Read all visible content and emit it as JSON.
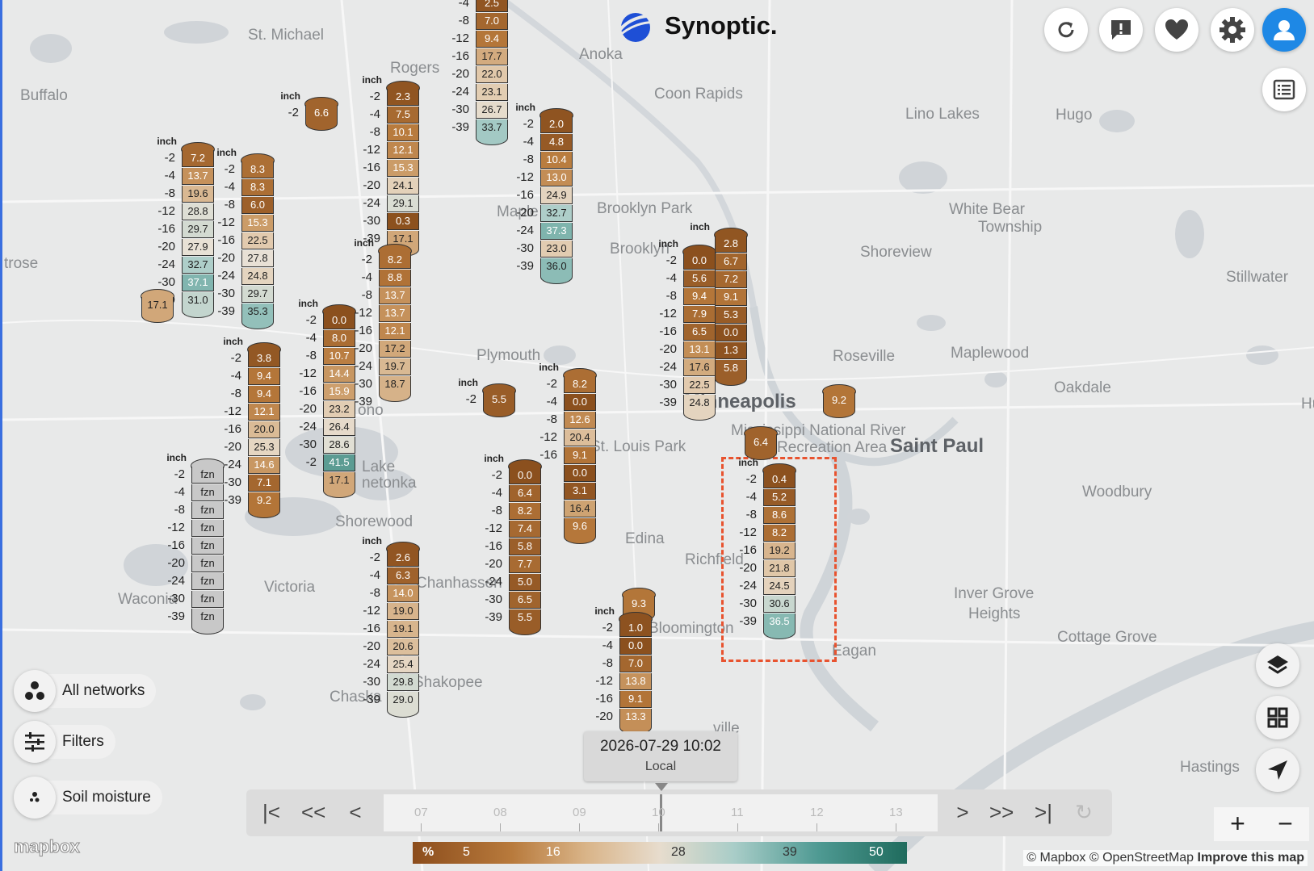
{
  "brand": {
    "name": "Synoptic.",
    "logo_icon": "synoptic-globe-icon"
  },
  "places": [
    {
      "id": "st-michael",
      "label": "St. Michael",
      "cls": ""
    },
    {
      "id": "anoka",
      "label": "Anoka",
      "cls": ""
    },
    {
      "id": "coon-rapids",
      "label": "Coon Rapids",
      "cls": ""
    },
    {
      "id": "buffalo",
      "label": "Buffalo",
      "cls": ""
    },
    {
      "id": "rogers",
      "label": "Rogers",
      "cls": ""
    },
    {
      "id": "lino-lakes",
      "label": "Lino Lakes",
      "cls": ""
    },
    {
      "id": "hugo",
      "label": "Hugo",
      "cls": ""
    },
    {
      "id": "brooklyn-park",
      "label": "Brooklyn Park",
      "cls": ""
    },
    {
      "id": "brooklyn",
      "label": "Brooklyn",
      "cls": ""
    },
    {
      "id": "white-bear",
      "label": "White Bear",
      "cls": ""
    },
    {
      "id": "township",
      "label": "Township",
      "cls": ""
    },
    {
      "id": "shoreview",
      "label": "Shoreview",
      "cls": ""
    },
    {
      "id": "stillwater",
      "label": "Stillwater",
      "cls": ""
    },
    {
      "id": "rose",
      "label": "trose",
      "cls": ""
    },
    {
      "id": "maple",
      "label": "Maple",
      "cls": ""
    },
    {
      "id": "plymouth",
      "label": "Plymouth",
      "cls": ""
    },
    {
      "id": "roseville",
      "label": "Roseville",
      "cls": ""
    },
    {
      "id": "maplewood",
      "label": "Maplewood",
      "cls": ""
    },
    {
      "id": "oakdale",
      "label": "Oakdale",
      "cls": ""
    },
    {
      "id": "minneapolis",
      "label": "Minneapolis",
      "cls": "big"
    },
    {
      "id": "saint-paul",
      "label": "Saint Paul",
      "cls": "big"
    },
    {
      "id": "mississippi",
      "label": "Mississippi National River",
      "cls": ""
    },
    {
      "id": "recreation",
      "label": "and Recreation Area",
      "cls": ""
    },
    {
      "id": "st-louis-park",
      "label": "St. Louis Park",
      "cls": ""
    },
    {
      "id": "woodbury",
      "label": "Woodbury",
      "cls": ""
    },
    {
      "id": "edina",
      "label": "Edina",
      "cls": ""
    },
    {
      "id": "richfield",
      "label": "Richfield",
      "cls": ""
    },
    {
      "id": "shorewood",
      "label": "Shorewood",
      "cls": ""
    },
    {
      "id": "victoria",
      "label": "Victoria",
      "cls": ""
    },
    {
      "id": "waconia",
      "label": "Waconia",
      "cls": ""
    },
    {
      "id": "chanhassen",
      "label": "Chanhassen",
      "cls": ""
    },
    {
      "id": "chaska",
      "label": "Chaska",
      "cls": ""
    },
    {
      "id": "shakopee",
      "label": "Shakopee",
      "cls": ""
    },
    {
      "id": "bloomington",
      "label": "Bloomington",
      "cls": ""
    },
    {
      "id": "eagan",
      "label": "Eagan",
      "cls": ""
    },
    {
      "id": "inver-grove",
      "label": "Inver Grove",
      "cls": ""
    },
    {
      "id": "heights",
      "label": "Heights",
      "cls": ""
    },
    {
      "id": "cottage-grove",
      "label": "Cottage Grove",
      "cls": ""
    },
    {
      "id": "hastings",
      "label": "Hastings",
      "cls": ""
    },
    {
      "id": "burnsville",
      "label": "ville",
      "cls": ""
    },
    {
      "id": "wayzata",
      "label": "ono",
      "cls": ""
    },
    {
      "id": "lake",
      "label": "Lake",
      "cls": ""
    },
    {
      "id": "minnetonka",
      "label": "netonka",
      "cls": ""
    },
    {
      "id": "hu",
      "label": "Hu",
      "cls": ""
    }
  ],
  "stacks": [
    {
      "id": "s1",
      "unit": "inch",
      "depths": [
        "-2",
        "-4",
        "-8",
        "-12",
        "-16",
        "-20",
        "-24",
        "-30",
        "-39"
      ],
      "values": [
        "7.2",
        "13.7",
        "19.6",
        "28.8",
        "29.7",
        "27.9",
        "32.7",
        "37.1",
        "31.0"
      ]
    },
    {
      "id": "s2",
      "unit": "inch",
      "depths": [
        "-2",
        "-4",
        "-8",
        "-12",
        "-16",
        "-20",
        "-24",
        "-30",
        "-39"
      ],
      "values": [
        "8.3",
        "8.3",
        "6.0",
        "15.3",
        "22.5",
        "27.8",
        "24.8",
        "29.7",
        "35.3"
      ]
    },
    {
      "id": "s3",
      "unit": "",
      "depths": [],
      "values": [
        "17.1"
      ]
    },
    {
      "id": "s4",
      "unit": "inch",
      "depths": [
        "-2"
      ],
      "values": [
        "6.6"
      ]
    },
    {
      "id": "s5",
      "unit": "inch",
      "depths": [
        "-2",
        "-4",
        "-8",
        "-12",
        "-16",
        "-20",
        "-24",
        "-30",
        "-39"
      ],
      "values": [
        "2.3",
        "7.5",
        "10.1",
        "12.1",
        "15.3",
        "24.1",
        "29.1",
        "0.3",
        "17.1"
      ]
    },
    {
      "id": "s6",
      "unit": "inch",
      "depths": [
        "-2",
        "-4",
        "-8",
        "-12",
        "-16",
        "-20",
        "-24",
        "-30",
        "-39"
      ],
      "values": [
        "8.2",
        "8.8",
        "13.7",
        "13.7",
        "12.1",
        "17.2",
        "19.7",
        "18.7"
      ]
    },
    {
      "id": "s7",
      "unit": "",
      "depths": [
        "-4",
        "-8",
        "-12",
        "-16",
        "-20",
        "-24",
        "-30",
        "-39"
      ],
      "values": [
        "2.5",
        "7.0",
        "9.4",
        "17.7",
        "22.0",
        "23.1",
        "26.7",
        "33.7"
      ]
    },
    {
      "id": "s8",
      "unit": "inch",
      "depths": [
        "-2",
        "-4",
        "-8",
        "-12",
        "-16",
        "-20",
        "-24",
        "-30",
        "-39"
      ],
      "values": [
        "2.0",
        "4.8",
        "10.4",
        "13.0",
        "24.9",
        "32.7",
        "37.3",
        "23.0",
        "36.0"
      ]
    },
    {
      "id": "s9",
      "unit": "inch",
      "depths": [
        "-2",
        "-4",
        "-8",
        "-12",
        "-16",
        "-20",
        "-24",
        "-30",
        "-39"
      ],
      "values": [
        "3.8",
        "9.4",
        "9.4",
        "12.1",
        "20.0",
        "25.3",
        "14.6",
        "7.1",
        "9.2"
      ]
    },
    {
      "id": "s10",
      "unit": "inch",
      "depths": [
        "-2",
        "-4",
        "-8",
        "-12",
        "-16",
        "-20",
        "-24",
        "-30",
        "-2"
      ],
      "values": [
        "0.0",
        "8.0",
        "10.7",
        "14.4",
        "15.9",
        "23.2",
        "26.4",
        "28.6",
        "41.5",
        "17.1"
      ]
    },
    {
      "id": "s11",
      "unit": "inch",
      "depths": [
        "-2",
        "-4",
        "-8",
        "-12",
        "-16",
        "-20",
        "-24",
        "-30",
        "-39"
      ],
      "values": [
        "fzn",
        "fzn",
        "fzn",
        "fzn",
        "fzn",
        "fzn",
        "fzn",
        "fzn",
        "fzn"
      ]
    },
    {
      "id": "s12",
      "unit": "inch",
      "depths": [
        "-2"
      ],
      "values": [
        "5.5"
      ]
    },
    {
      "id": "s13",
      "unit": "inch",
      "depths": [
        "-2",
        "-4",
        "-8",
        "-12",
        "-16"
      ],
      "values": [
        "8.2",
        "0.0",
        "12.6",
        "20.4",
        "9.1",
        "0.0",
        "3.1",
        "16.4",
        "9.6"
      ]
    },
    {
      "id": "s14",
      "unit": "inch",
      "depths": [
        "-2",
        "-4",
        "-8",
        "-12",
        "-16",
        "-20",
        "-24",
        "-30",
        "-39"
      ],
      "values": [
        "0.0",
        "6.4",
        "8.2",
        "7.4",
        "5.8",
        "7.7",
        "5.0",
        "6.5",
        "5.5"
      ]
    },
    {
      "id": "s15",
      "unit": "inch",
      "depths": [
        "-2",
        "-4",
        "-8",
        "-12",
        "-16",
        "-20",
        "-24",
        "-30",
        "-39"
      ],
      "values": [
        "2.6",
        "6.3",
        "14.0",
        "19.0",
        "19.1",
        "20.6",
        "25.4",
        "29.8",
        "29.0"
      ]
    },
    {
      "id": "s16",
      "unit": "inch",
      "depths": [
        "-2",
        "-4",
        "-8",
        "-12",
        "-16",
        "-20",
        "-24",
        "-30",
        "-39"
      ],
      "values": [
        "0.0",
        "5.6",
        "9.4",
        "7.9",
        "6.5",
        "13.1",
        "17.6",
        "22.5",
        "24.8"
      ]
    },
    {
      "id": "s17",
      "unit": "inch",
      "depths": [],
      "values": [
        "2.8",
        "6.7",
        "7.2",
        "9.1",
        "5.3",
        "0.0",
        "1.3",
        "5.8"
      ]
    },
    {
      "id": "s18",
      "unit": "",
      "depths": [],
      "values": [
        "9.2"
      ]
    },
    {
      "id": "s19",
      "unit": "",
      "depths": [],
      "values": [
        "6.4"
      ]
    },
    {
      "id": "s20",
      "unit": "inch",
      "depths": [
        "-2",
        "-4",
        "-8",
        "-12",
        "-16",
        "-20",
        "-24",
        "-30",
        "-39"
      ],
      "values": [
        "0.4",
        "5.2",
        "8.6",
        "8.2",
        "19.2",
        "21.8",
        "24.5",
        "30.6",
        "36.5"
      ]
    },
    {
      "id": "s21",
      "unit": "",
      "depths": [],
      "values": [
        "9.3"
      ]
    },
    {
      "id": "s22",
      "unit": "inch",
      "depths": [
        "-2",
        "-4",
        "-8",
        "-12",
        "-16",
        "-20"
      ],
      "values": [
        "1.0",
        "0.0",
        "7.0",
        "13.8",
        "9.1",
        "13.3"
      ]
    }
  ],
  "top_buttons": [
    {
      "name": "refresh-button",
      "icon": "refresh-icon"
    },
    {
      "name": "feedback-button",
      "icon": "feedback-icon"
    },
    {
      "name": "favorites-button",
      "icon": "heart-icon"
    },
    {
      "name": "settings-button",
      "icon": "gear-icon"
    },
    {
      "name": "account-button",
      "icon": "user-icon"
    }
  ],
  "controls": {
    "networks_label": "All networks",
    "filters_label": "Filters",
    "variable_label": "Soil moisture"
  },
  "time": {
    "datetime": "2026-07-29 10:02",
    "zone": "Local",
    "ticks": [
      "07",
      "08",
      "09",
      "10",
      "11",
      "12",
      "13"
    ],
    "buttons": [
      "|<",
      "<<",
      "<",
      ">",
      ">>",
      ">|"
    ]
  },
  "legend": {
    "unit": "%",
    "ticks": [
      "5",
      "16",
      "28",
      "39",
      "50"
    ]
  },
  "zoom": {
    "in": "+",
    "out": "−"
  },
  "attribution": {
    "mapbox": "© Mapbox",
    "osm": "© OpenStreetMap",
    "improve": "Improve this map"
  },
  "mapbox_logo": "mapbox",
  "colors": {
    "highlight": "#e8532f",
    "accent": "#1e88e5",
    "brand_blue": "#1e4fd6"
  }
}
